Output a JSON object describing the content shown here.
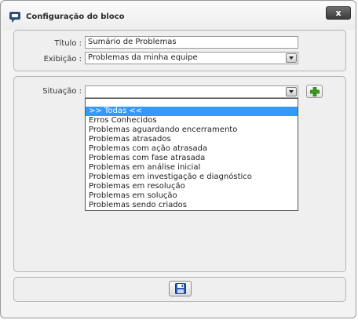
{
  "dialog": {
    "title": "Configuração do bloco",
    "close_label": "x",
    "title_icon": "speech-bubble-icon"
  },
  "form": {
    "titulo_label": "Título :",
    "titulo_value": "Sumário de Problemas",
    "exibicao_label": "Exibição :",
    "exibicao_value": "Problemas da minha equipe",
    "situacao_label": "Situação :",
    "situacao_value": ""
  },
  "situacao_options": [
    ">> Todas <<",
    "Erros Conhecidos",
    "Problemas aguardando encerramento",
    "Problemas atrasados",
    "Problemas com ação atrasada",
    "Problemas com fase atrasada",
    "Problemas em análise inicial",
    "Problemas em investigação e diagnóstico",
    "Problemas em resolução",
    "Problemas em solução",
    "Problemas sendo criados"
  ],
  "icons": {
    "add": "green-plus-icon",
    "save": "floppy-disk-icon",
    "dropdown": "chevron-down-icon"
  },
  "colors": {
    "highlight": "#3399ff",
    "add_green": "#3a9a1f",
    "save_blue": "#2d5fb8"
  }
}
